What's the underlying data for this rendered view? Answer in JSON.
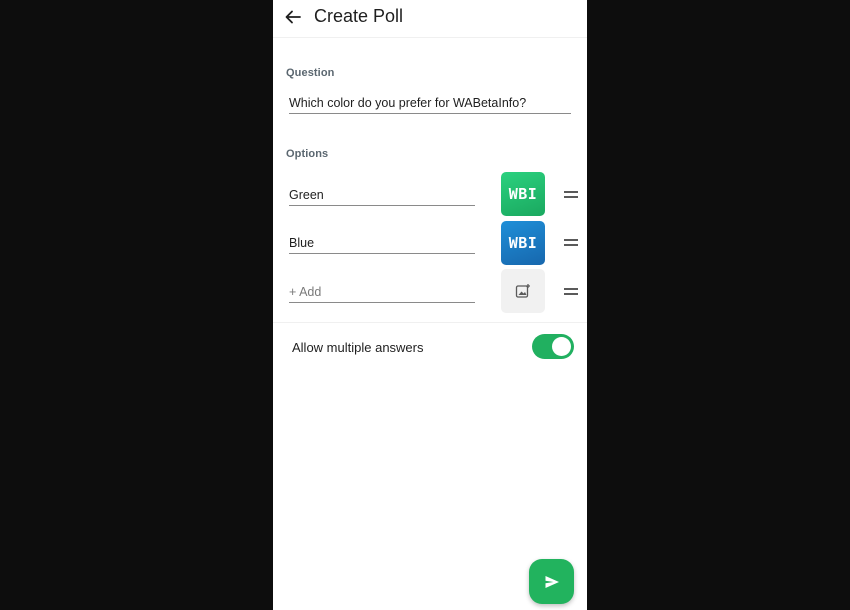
{
  "header": {
    "back_icon": "arrow-back-icon",
    "title": "Create Poll"
  },
  "question": {
    "label": "Question",
    "value": "Which color do you prefer for WABetaInfo?"
  },
  "options": {
    "label": "Options",
    "items": [
      {
        "value": "Green",
        "image_text": "WBI",
        "image_color": "#25c573"
      },
      {
        "value": "Blue",
        "image_text": "WBI",
        "image_color": "#1b7cc6"
      }
    ],
    "add_placeholder": "+ Add",
    "add_image_icon": "add-image-icon",
    "drag_icon": "drag-handle-icon"
  },
  "multiple_answers": {
    "label": "Allow multiple answers",
    "enabled": true
  },
  "send_button": {
    "icon": "send-icon",
    "color": "#22b35e"
  },
  "colors": {
    "accent": "#21b060",
    "background": "#0d0d0d"
  }
}
